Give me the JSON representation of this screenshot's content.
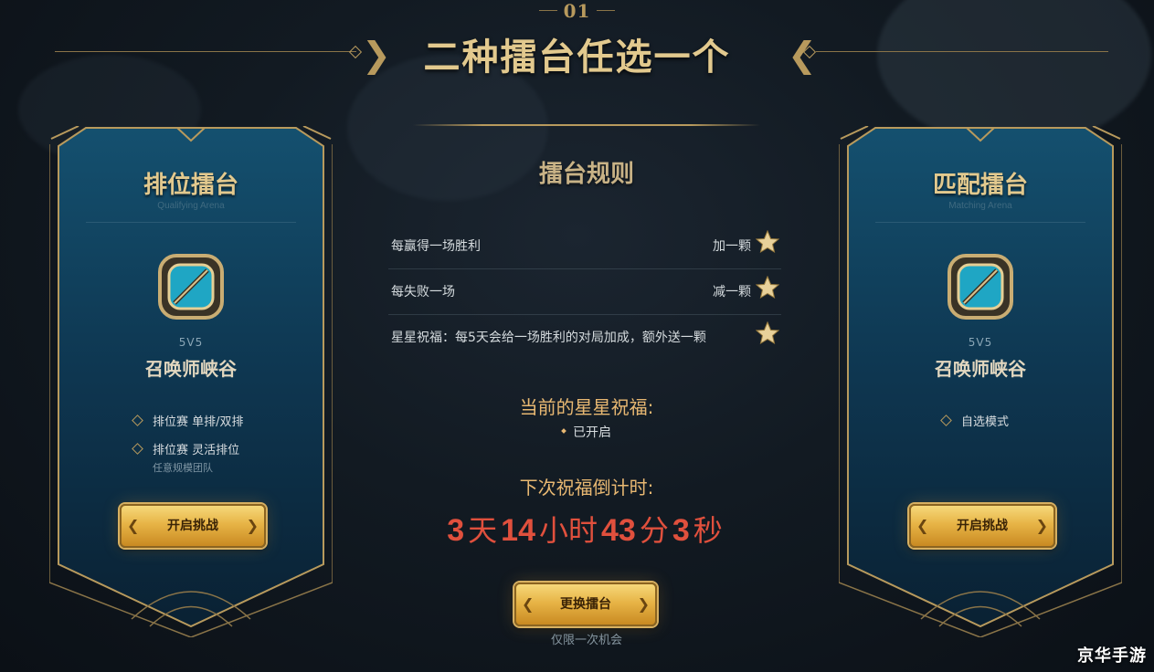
{
  "header": {
    "number": "01",
    "title": "二种擂台任选一个"
  },
  "left_card": {
    "title": "排位擂台",
    "subtitle": "Qualifying Arena",
    "mode": "5V5",
    "map": "召唤师峡谷",
    "features": [
      "排位赛 单排/双排",
      "排位赛 灵活排位"
    ],
    "feature_note": "任意规模团队",
    "button_label": "开启挑战"
  },
  "right_card": {
    "title": "匹配擂台",
    "subtitle": "Matching Arena",
    "mode": "5V5",
    "map": "召唤师峡谷",
    "features": [
      "自选模式"
    ],
    "button_label": "开启挑战"
  },
  "rules": {
    "title": "擂台规则",
    "items": [
      {
        "text": "每赢得一场胜利",
        "result": "加一颗"
      },
      {
        "text": "每失败一场",
        "result": "减一颗"
      },
      {
        "text": "星星祝福：每5天会给一场胜利的对局加成，额外送一颗",
        "result": ""
      }
    ]
  },
  "blessing": {
    "label": "当前的星星祝福:",
    "status": "已开启"
  },
  "countdown": {
    "label": "下次祝福倒计时:",
    "days": "3",
    "days_unit": "天",
    "hours": "14",
    "hours_unit": "小时",
    "minutes": "43",
    "minutes_unit": "分",
    "seconds": "3",
    "seconds_unit": "秒"
  },
  "switch": {
    "button_label": "更换擂台",
    "note": "仅限一次机会"
  },
  "watermark": "京华手游",
  "colors": {
    "gold": "#e2c98e",
    "frame_gold": "#b89a5d",
    "countdown_red": "#e0503d",
    "label_orange": "#e8b872",
    "card_blue": "#0f3a54"
  }
}
